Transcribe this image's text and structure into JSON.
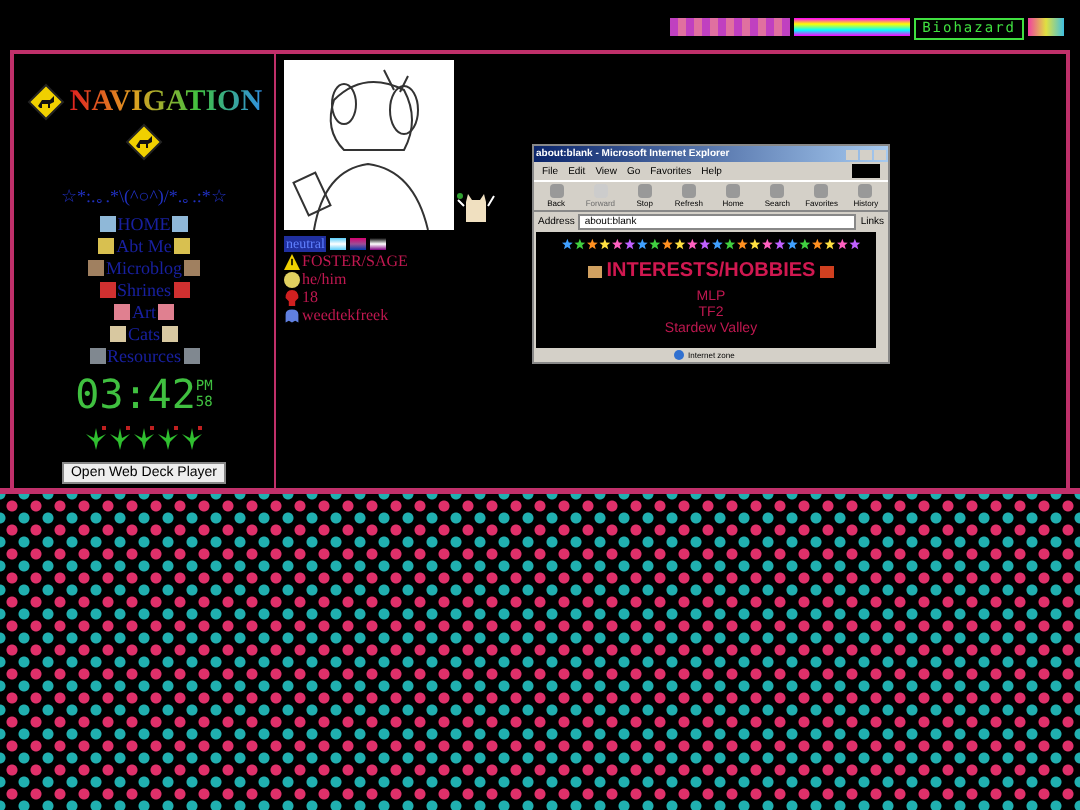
{
  "header_badges": [
    {
      "kind": "stripes"
    },
    {
      "kind": "rainbow"
    },
    {
      "kind": "label",
      "text": "Biohazard"
    },
    {
      "kind": "stripes"
    }
  ],
  "navigation": {
    "title": "NAVIGATION",
    "divider": "☆*:.｡.*\\(^○^)/*.｡.:*☆",
    "items": [
      {
        "label": "HOME",
        "color": "#8fb8d8"
      },
      {
        "label": "Abt Me",
        "color": "#d8c050"
      },
      {
        "label": "Microblog",
        "color": "#a08060"
      },
      {
        "label": "Shrines",
        "color": "#d03030"
      },
      {
        "label": "Art",
        "color": "#e08090"
      },
      {
        "label": "Cats",
        "color": "#d8c8a0"
      },
      {
        "label": "Resources",
        "color": "#808890"
      }
    ],
    "clock": {
      "time": "03:42",
      "ampm": "PM",
      "seconds": "58"
    },
    "player_button": "Open Web Deck Player"
  },
  "profile": {
    "badge": "neutral",
    "facts": [
      {
        "kind": "warning",
        "text": "FOSTER/SAGE"
      },
      {
        "kind": "smiley",
        "text": "he/him"
      },
      {
        "kind": "skull",
        "text": "18"
      },
      {
        "kind": "ghost",
        "text": "weedtekfreek"
      }
    ]
  },
  "browser": {
    "title": "about:blank - Microsoft Internet Explorer",
    "menu": [
      "File",
      "Edit",
      "View",
      "Go",
      "Favorites",
      "Help"
    ],
    "toolbar": [
      {
        "label": "Back",
        "disabled": false
      },
      {
        "label": "Forward",
        "disabled": true
      },
      {
        "label": "Stop",
        "disabled": false
      },
      {
        "label": "Refresh",
        "disabled": false
      },
      {
        "label": "Home",
        "disabled": false
      },
      {
        "label": "Search",
        "disabled": false
      },
      {
        "label": "Favorites",
        "disabled": false
      },
      {
        "label": "History",
        "disabled": false
      }
    ],
    "address_label": "Address",
    "address": "about:blank",
    "links": "Links",
    "heading": "INTERESTS/HOBBIES",
    "interests": [
      "MLP",
      "TF2",
      "Stardew Valley"
    ],
    "status": "Internet zone"
  }
}
